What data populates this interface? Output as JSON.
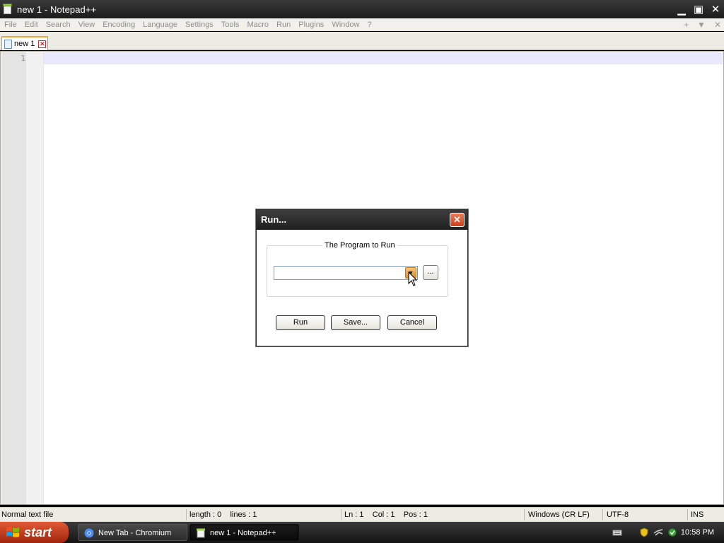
{
  "window": {
    "title": "new 1 - Notepad++",
    "buttons": {
      "minimize": "▁",
      "restore": "▣",
      "close": "✕"
    }
  },
  "menubar": {
    "items": [
      "File",
      "Edit",
      "Search",
      "View",
      "Encoding",
      "Language",
      "Settings",
      "Tools",
      "Macro",
      "Run",
      "Plugins",
      "Window",
      "?"
    ],
    "right_icons": [
      "plus-icon",
      "dropdown-icon",
      "close-icon"
    ]
  },
  "tabs": [
    {
      "label": "new 1",
      "active": true
    }
  ],
  "editor": {
    "line_numbers": [
      "1"
    ],
    "content": ""
  },
  "run_dialog": {
    "title": "Run...",
    "close": "✕",
    "group_label": "The Program to Run",
    "program_value": "",
    "browse_label": "...",
    "buttons": {
      "run": "Run",
      "save": "Save...",
      "cancel": "Cancel"
    }
  },
  "statusbar": {
    "file_type": "Normal text file",
    "length_lines": "length : 0    lines : 1",
    "position": "Ln : 1    Col : 1    Pos : 1",
    "eol": "Windows (CR LF)",
    "encoding": "UTF-8",
    "mode": "INS"
  },
  "taskbar": {
    "start_label": "start",
    "tasks": [
      {
        "label": "New Tab - Chromium",
        "icon": "chromium-icon",
        "active": false
      },
      {
        "label": "new 1 - Notepad++",
        "icon": "notepadpp-icon",
        "active": true
      }
    ],
    "tray_icons": [
      "keyboard-icon",
      "security-shield-icon",
      "network-icon",
      "update-icon"
    ],
    "clock": "10:58 PM"
  },
  "colors": {
    "current_line": "#e8e8ff",
    "tab_accent": "#f5a33b",
    "start_button": "#c9401a"
  }
}
